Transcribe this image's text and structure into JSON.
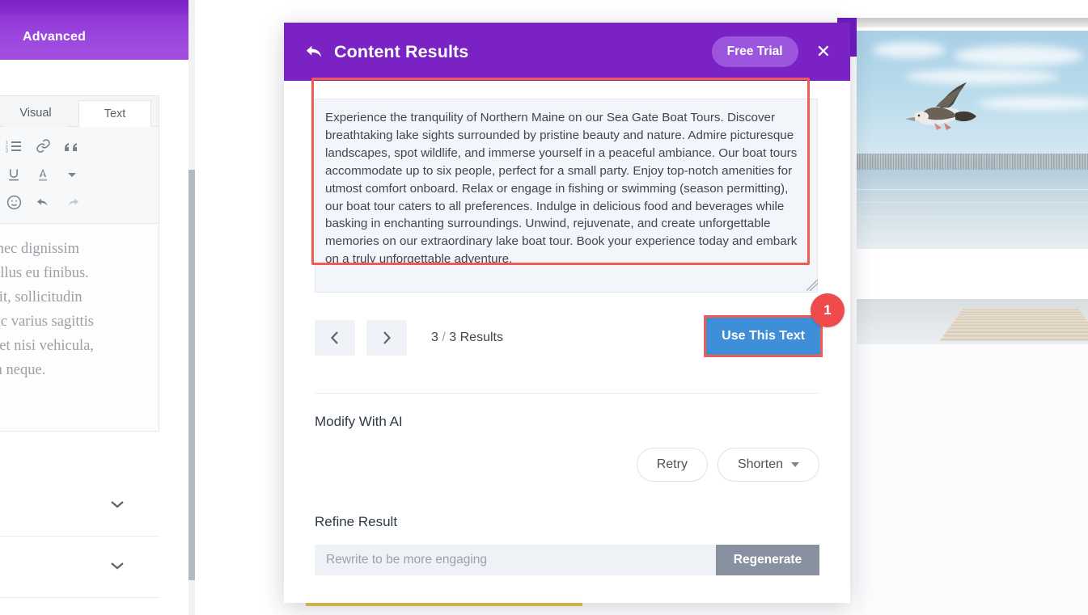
{
  "editor_panel": {
    "advanced_tab_label": "Advanced",
    "tabs": [
      {
        "label": "Visual",
        "name": "tab-visual"
      },
      {
        "label": "Text",
        "name": "tab-text"
      }
    ],
    "toolbar_icons": [
      "bulleted-list-icon",
      "numbered-list-icon",
      "link-icon",
      "blockquote-icon",
      "strikethrough-icon",
      "underline-icon",
      "text-color-icon",
      "chevron-down-icon",
      "special-character-icon",
      "emoji-icon",
      "undo-icon",
      "redo-icon"
    ],
    "content_lines": [
      "nc, nec dignissim",
      "et tellus eu finibus.",
      "scipit, sollicitudin",
      " Nunc varius sagittis",
      "ean et nisi vehicula,",
      "nsan neque."
    ],
    "accordion_icons": [
      "chevron-down-icon",
      "chevron-down-icon"
    ]
  },
  "page_preview": {
    "images": [
      {
        "name": "bird-over-lake-photo",
        "alt": "Bird flying over a lake with forest treeline"
      },
      {
        "name": "wooden-dock-photo",
        "alt": "Wooden dock on the lake"
      }
    ]
  },
  "modal": {
    "title": "Content Results",
    "back_icon": "back-arrow-icon",
    "free_trial_label": "Free Trial",
    "close_icon": "close-icon",
    "header_color": "#7a22c4",
    "result_text": "Experience the tranquility of Northern Maine on our Sea Gate Boat Tours. Discover breathtaking lake sights surrounded by pristine beauty and nature. Admire picturesque landscapes, spot wildlife, and immerse yourself in a peaceful ambiance. Our boat tours accommodate up to six people, perfect for a small party. Enjoy top-notch amenities for utmost comfort onboard. Relax or engage in fishing or swimming (season permitting), our boat tour caters to all preferences. Indulge in delicious food and beverages while basking in enchanting surroundings. Unwind, rejuvenate, and create unforgettable memories on our extraordinary lake boat tour. Book your experience today and embark on a truly unforgettable adventure.",
    "pager": {
      "prev_icon": "chevron-left-icon",
      "next_icon": "chevron-right-icon",
      "current": "3",
      "separator": "/",
      "total_label": "3 Results"
    },
    "use_this_text_label": "Use This Text",
    "use_this_text_color": "#3e8ed8",
    "highlight_color": "#f15b52",
    "badge_number": "1",
    "badge_color": "#ef4b4b",
    "modify_section": {
      "title": "Modify With AI",
      "retry_label": "Retry",
      "shorten_label": "Shorten",
      "shorten_caret_icon": "caret-down-icon"
    },
    "refine_section": {
      "title": "Refine Result",
      "input_value": "",
      "input_placeholder": "Rewrite to be more engaging",
      "regenerate_label": "Regenerate"
    }
  }
}
